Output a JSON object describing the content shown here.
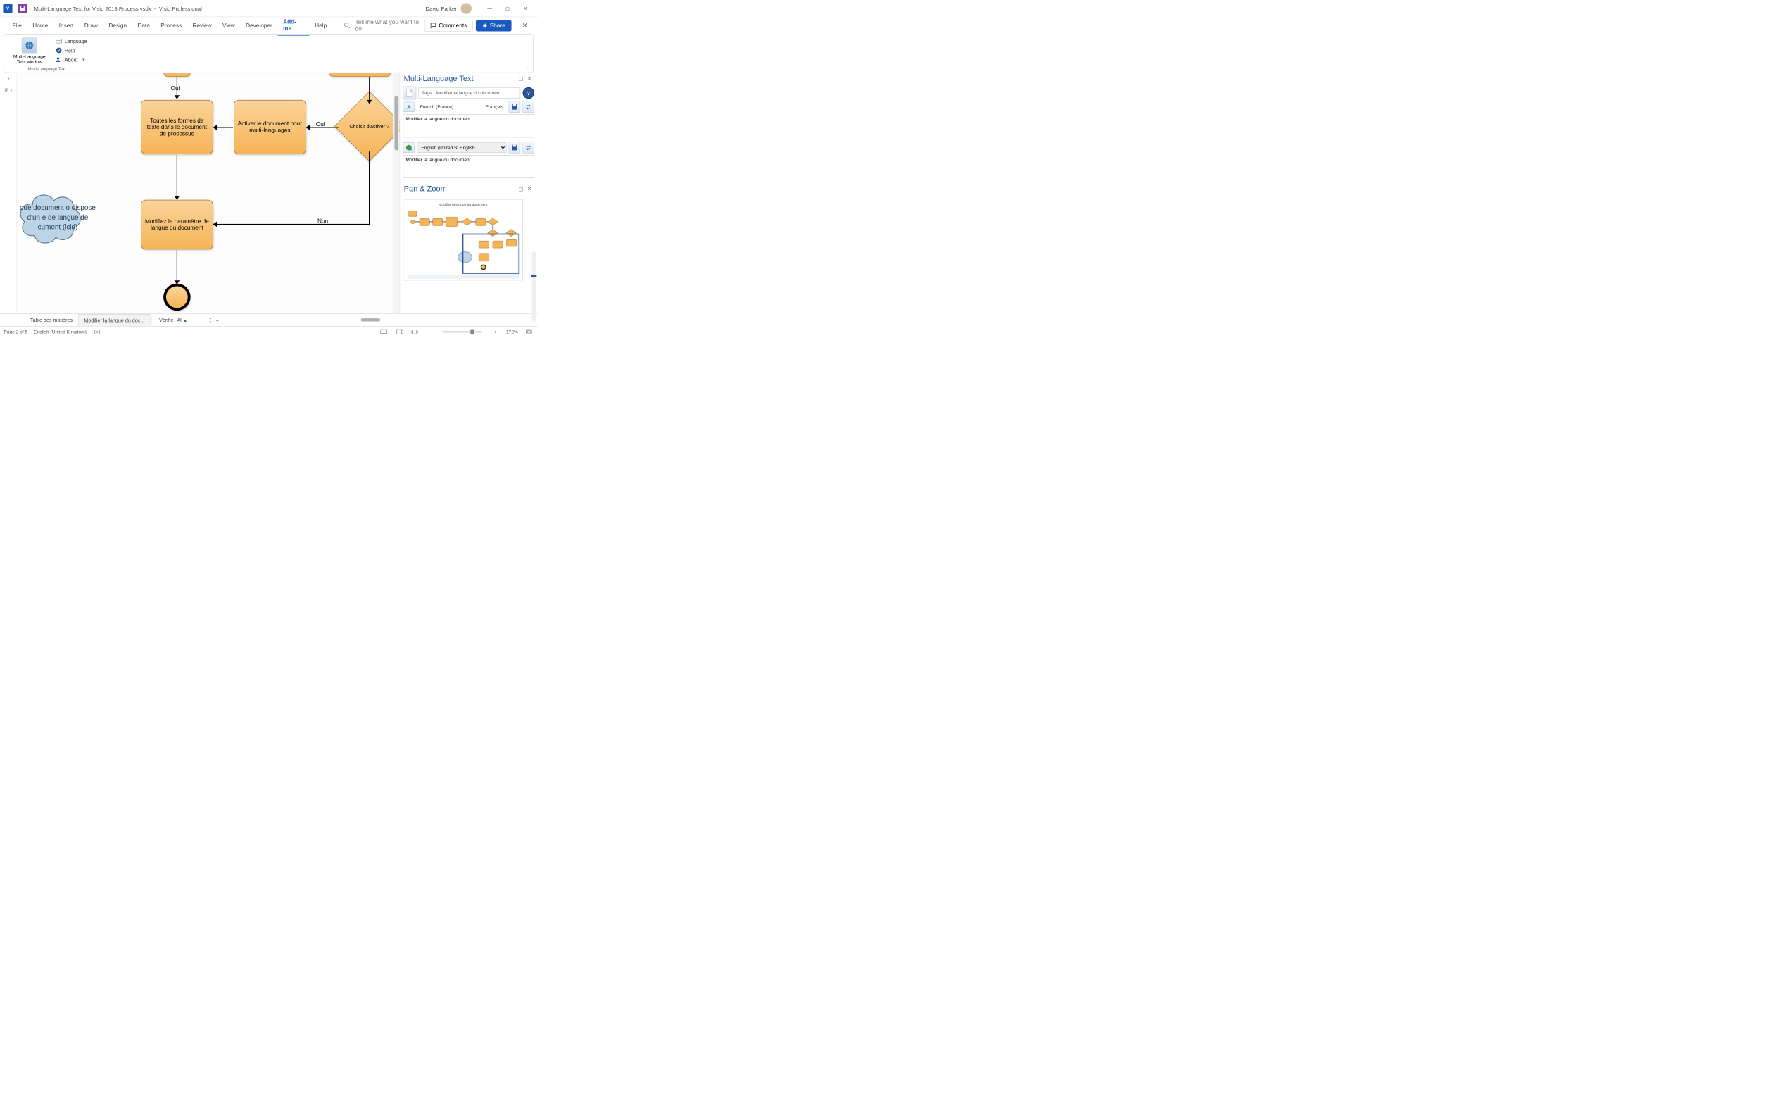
{
  "titlebar": {
    "filename": "Multi-Language Text for Visio 2013 Process.vsdx",
    "separator": "-",
    "app": "Visio Professional",
    "user": "David Parker"
  },
  "menubar": {
    "items": [
      "File",
      "Home",
      "Insert",
      "Draw",
      "Design",
      "Data",
      "Process",
      "Review",
      "View",
      "Developer",
      "Add-ins",
      "Help"
    ],
    "active_index": 10,
    "search_placeholder": "Tell me what you want to do",
    "comments": "Comments",
    "share": "Share"
  },
  "ribbon": {
    "big_button": "Multi-Language Text window",
    "items": [
      "Language",
      "Help",
      "About"
    ],
    "group_label": "Multi-Language Text"
  },
  "canvas": {
    "label_oui_top": "Oui",
    "shape1": "Toutes les formes de texte dans le document de processus",
    "shape2": "Activer le document pour multi-languages",
    "diamond": "Choisir d'activer ?",
    "label_oui_mid": "Oui",
    "label_non": "Non",
    "shape3": "Modifiez le paramètre de langue du document",
    "cloud": "que document o dispose d'un e de langue de cument (lcid)"
  },
  "mlpanel": {
    "title": "Multi-Language Text",
    "page_label": "Page : Modifier la langue du document",
    "lang1a": "French (France)",
    "lang1b": "Français",
    "text1": "Modifier la langue du document",
    "lang2_select": "English (United St  English",
    "text2": "Modifier la langue du document"
  },
  "pzpanel": {
    "title": "Pan & Zoom",
    "thumb_title": "Modifier la langue du document"
  },
  "tabs": {
    "items": [
      "Table des matières",
      "Modifier la langue du doc..."
    ],
    "active_index": 1,
    "filter1": "Vérifie",
    "filter2": "All"
  },
  "statusbar": {
    "page": "Page 2 of 5",
    "lang": "English (United Kingdom)",
    "zoom": "172%"
  }
}
